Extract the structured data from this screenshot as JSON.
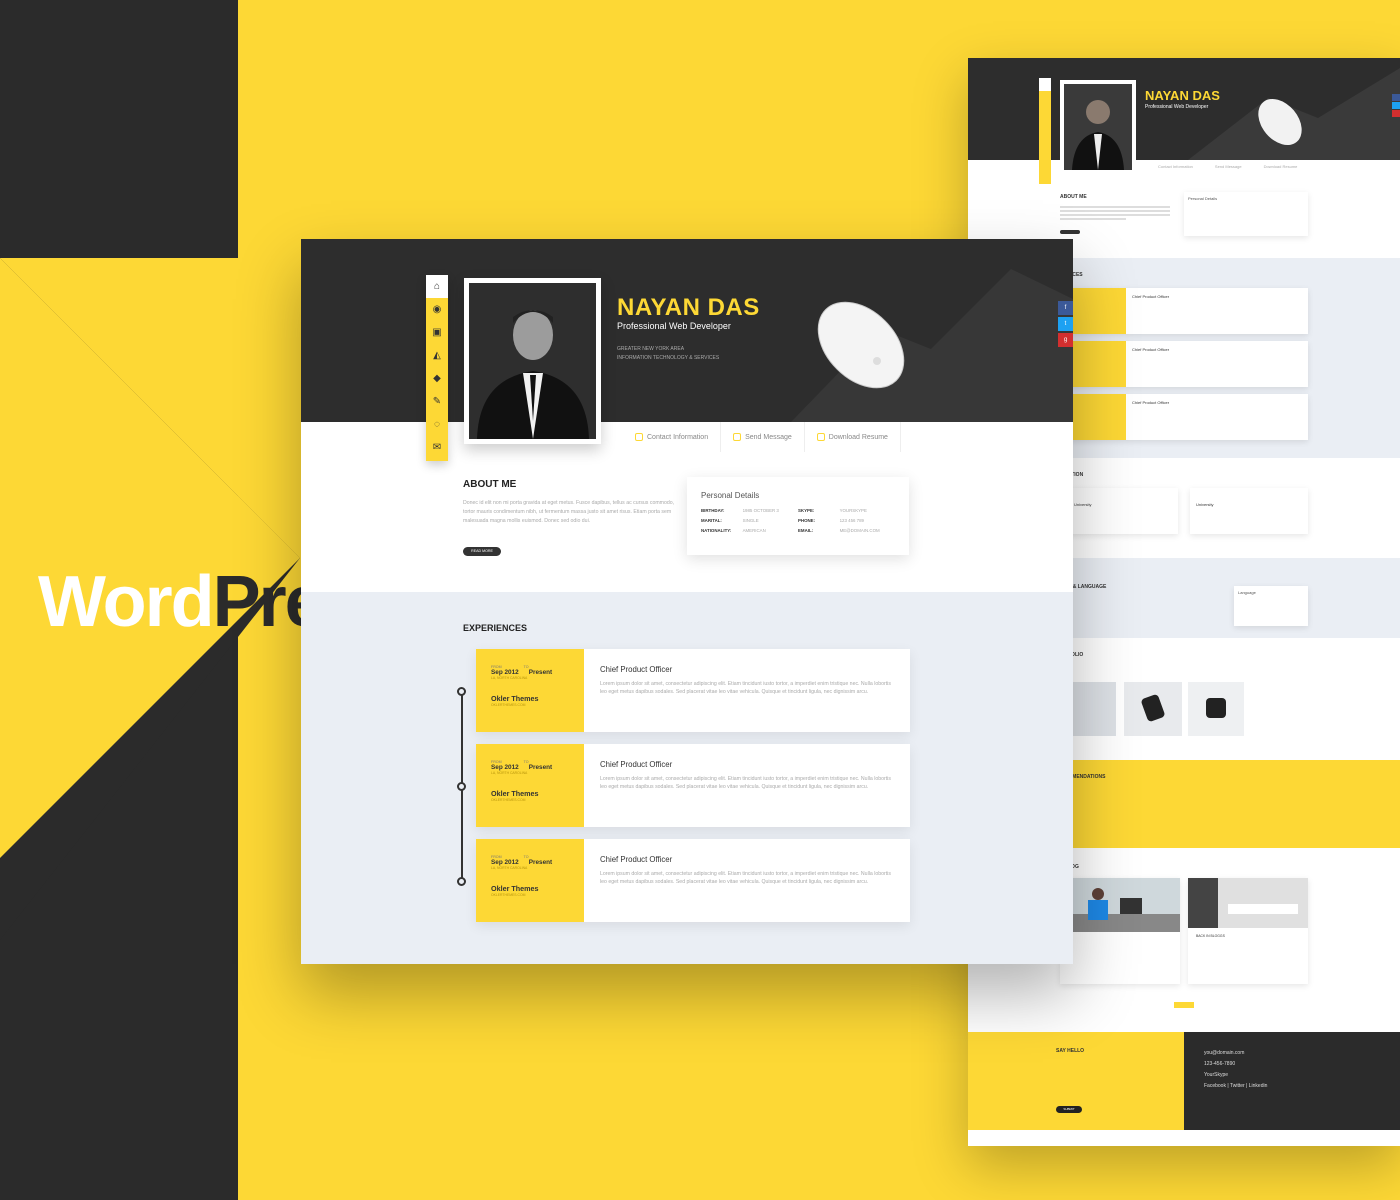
{
  "brand": {
    "word": "Word",
    "press": "Press"
  },
  "colors": {
    "accent": "#fdd835",
    "dark": "#2b2b2b",
    "header": "#2d2d2d",
    "section_bg": "#eaeef4"
  },
  "front": {
    "name": "NAYAN DAS",
    "role": "Professional Web Developer",
    "location_1": "GREATER NEW YORK AREA",
    "location_2": "INFORMATION TECHNOLOGY & SERVICES",
    "nav_icons": [
      "home-icon",
      "eye-icon",
      "briefcase-icon",
      "graduation-cap-icon",
      "diamond-icon",
      "pencil-icon",
      "chat-icon",
      "envelope-icon"
    ],
    "social_icons": [
      "facebook-icon",
      "twitter-icon",
      "google-plus-icon"
    ],
    "tabs": [
      {
        "label": "Contact Information"
      },
      {
        "label": "Send Message"
      },
      {
        "label": "Download Resume"
      }
    ],
    "about": {
      "title": "ABOUT ME",
      "text": "Donec id elit non mi porta gravida at eget metus. Fusce dapibus, tellus ac cursus commodo, tortor mauris condimentum nibh, ut fermentum massa justo sit amet risus. Etiam porta sem malesuada magna mollis euismod. Donec sed odio dui.",
      "button": "READ MORE"
    },
    "personal": {
      "title": "Personal Details",
      "rows": [
        {
          "k1": "BIRTHDAY:",
          "v1": "1985 OCTOBER 3",
          "k2": "SKYPE:",
          "v2": "YOURSKYPE"
        },
        {
          "k1": "MARITAL:",
          "v1": "SINGLE",
          "k2": "PHONE:",
          "v2": "123 456 789"
        },
        {
          "k1": "NATIONALITY:",
          "v1": "AMERICAN",
          "k2": "EMAIL:",
          "v2": "ME@DOMAIN.COM"
        }
      ]
    },
    "experiences": {
      "title": "EXPERIENCES",
      "items": [
        {
          "from_label": "FROM",
          "to_label": "TO",
          "from": "Sep 2012",
          "to": "Present",
          "location": "LA, NORTH CAROLINA",
          "company": "Okler Themes",
          "link": "OKLERTHEMES.COM",
          "position": "Chief Product Officer",
          "text": "Lorem ipsum dolor sit amet, consectetur adipiscing elit. Etiam tincidunt iusto tortor, a imperdiet enim tristique nec. Nulla lobortis leo eget metus dapibus sodales. Sed placerat vitae leo vitae vehicula. Quisque et tincidunt ligula, nec dignissim arcu."
        },
        {
          "from_label": "FROM",
          "to_label": "TO",
          "from": "Sep 2012",
          "to": "Present",
          "location": "LA, NORTH CAROLINA",
          "company": "Okler Themes",
          "link": "OKLERTHEMES.COM",
          "position": "Chief Product Officer",
          "text": "Lorem ipsum dolor sit amet, consectetur adipiscing elit. Etiam tincidunt iusto tortor, a imperdiet enim tristique nec. Nulla lobortis leo eget metus dapibus sodales. Sed placerat vitae leo vitae vehicula. Quisque et tincidunt ligula, nec dignissim arcu."
        },
        {
          "from_label": "FROM",
          "to_label": "TO",
          "from": "Sep 2012",
          "to": "Present",
          "location": "LA, NORTH CAROLINA",
          "company": "Okler Themes",
          "link": "OKLERTHEMES.COM",
          "position": "Chief Product Officer",
          "text": "Lorem ipsum dolor sit amet, consectetur adipiscing elit. Etiam tincidunt iusto tortor, a imperdiet enim tristique nec. Nulla lobortis leo eget metus dapibus sodales. Sed placerat vitae leo vitae vehicula. Quisque et tincidunt ligula, nec dignissim arcu."
        }
      ]
    }
  },
  "back": {
    "name": "NAYAN DAS",
    "role": "Professional Web Developer",
    "tabs": [
      "Contact Information",
      "Send Message",
      "Download Resume"
    ],
    "about_title": "ABOUT ME",
    "personal_title": "Personal Details",
    "exp_title": "EXPERIENCES",
    "exp_position": "Chief Product Officer",
    "edu_title": "EDUCATION",
    "edu_item": "University",
    "skills_title": "SKILLS & LANGUAGE",
    "lang_title": "Language",
    "portfolio_title": "PORTFOLIO",
    "reco_title": "RECOMMENDATIONS",
    "blog_title": "BLOG",
    "blog_post": "BACK IN BLOGGS",
    "hello_title": "SAY HELLO",
    "submit": "SUBMIT",
    "email": "you@domain.com",
    "phone": "123-456-7890",
    "skype": "YourSkype",
    "social_links": "Facebook | Twitter | Linkedin"
  }
}
